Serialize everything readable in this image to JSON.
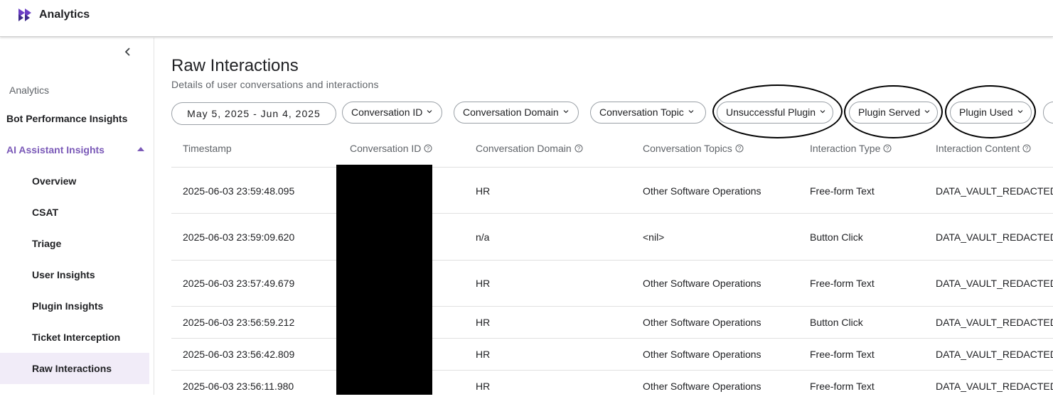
{
  "app": {
    "title": "Analytics"
  },
  "sidebar": {
    "section_label": "Analytics",
    "groups": [
      {
        "label": "Bot Performance Insights"
      },
      {
        "label": "AI Assistant Insights"
      }
    ],
    "items": [
      {
        "label": "Overview"
      },
      {
        "label": "CSAT"
      },
      {
        "label": "Triage"
      },
      {
        "label": "User Insights"
      },
      {
        "label": "Plugin Insights"
      },
      {
        "label": "Ticket Interception"
      },
      {
        "label": "Raw Interactions"
      }
    ]
  },
  "main": {
    "title": "Raw Interactions",
    "subtitle": "Details of user conversations and interactions"
  },
  "filters": {
    "date_range": "May 5, 2025 - Jun 4, 2025",
    "items": [
      {
        "label": "Conversation ID"
      },
      {
        "label": "Conversation Domain"
      },
      {
        "label": "Conversation Topic"
      },
      {
        "label": "Unsuccessful Plugin"
      },
      {
        "label": "Plugin Served"
      },
      {
        "label": "Plugin Used"
      }
    ]
  },
  "table": {
    "columns": [
      {
        "label": "Timestamp"
      },
      {
        "label": "Conversation ID"
      },
      {
        "label": "Conversation Domain"
      },
      {
        "label": "Conversation Topics"
      },
      {
        "label": "Interaction Type"
      },
      {
        "label": "Interaction Content"
      }
    ],
    "rows": [
      {
        "timestamp": "2025-06-03 23:59:48.095",
        "domain": "HR",
        "topics": "Other Software Operations",
        "type": "Free-form Text",
        "content": "DATA_VAULT_REDACTED"
      },
      {
        "timestamp": "2025-06-03 23:59:09.620",
        "domain": "n/a",
        "topics": "<nil>",
        "type": "Button Click",
        "content": "DATA_VAULT_REDACTED"
      },
      {
        "timestamp": "2025-06-03 23:57:49.679",
        "domain": "HR",
        "topics": "Other Software Operations",
        "type": "Free-form Text",
        "content": "DATA_VAULT_REDACTED"
      },
      {
        "timestamp": "2025-06-03 23:56:59.212",
        "domain": "HR",
        "topics": "Other Software Operations",
        "type": "Button Click",
        "content": "DATA_VAULT_REDACTED"
      },
      {
        "timestamp": "2025-06-03 23:56:42.809",
        "domain": "HR",
        "topics": "Other Software Operations",
        "type": "Free-form Text",
        "content": "DATA_VAULT_REDACTED"
      },
      {
        "timestamp": "2025-06-03 23:56:11.980",
        "domain": "HR",
        "topics": "Other Software Operations",
        "type": "Free-form Text",
        "content": "DATA_VAULT_REDACTED"
      }
    ]
  },
  "colors": {
    "accent": "#7b5ab8",
    "selected_bg": "#f1ecf8",
    "redaction": "#000000"
  },
  "icons": {
    "logo": "brand-logo-icon",
    "collapse": "chevron-left-icon",
    "filter_chevron": "chevron-down-icon",
    "help": "help-circle-icon"
  }
}
